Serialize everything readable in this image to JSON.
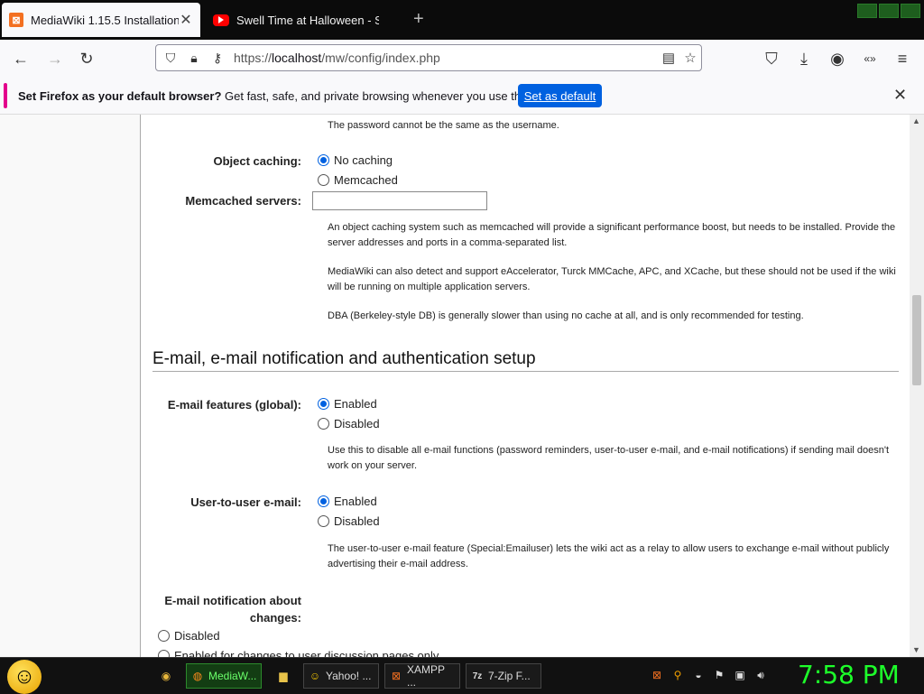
{
  "browser": {
    "tabs": [
      {
        "title": "MediaWiki 1.15.5 Installation",
        "active": true,
        "icon": "xampp-icon"
      },
      {
        "title": "Swell Time at Halloween - Shor",
        "active": false,
        "icon": "youtube-icon"
      }
    ],
    "new_tab_glyph": "+",
    "url": {
      "scheme": "https://",
      "host": "localhost",
      "path": "/mw/config/index.php"
    }
  },
  "notification": {
    "bold": "Set Firefox as your default browser?",
    "text": " Get fast, safe, and private browsing whenever you use the web.",
    "button": "Set as default"
  },
  "form": {
    "password_note": "The password cannot be the same as the username.",
    "object_caching": {
      "label": "Object caching:",
      "options": [
        "No caching",
        "Memcached"
      ],
      "selected": 0
    },
    "memcached": {
      "label": "Memcached servers:",
      "value": ""
    },
    "caching_help": [
      "An object caching system such as memcached will provide a significant performance boost, but needs to be installed. Provide the server addresses and ports in a comma-separated list.",
      "MediaWiki can also detect and support eAccelerator, Turck MMCache, APC, and XCache, but these should not be used if the wiki will be running on multiple application servers.",
      "DBA (Berkeley-style DB) is generally slower than using no cache at all, and is only recommended for testing."
    ],
    "section_heading": "E-mail, e-mail notification and authentication setup",
    "email_global": {
      "label": "E-mail features (global):",
      "options": [
        "Enabled",
        "Disabled"
      ],
      "selected": 0,
      "help": "Use this to disable all e-mail functions (password reminders, user-to-user e-mail, and e-mail notifications) if sending mail doesn't work on your server."
    },
    "user_email": {
      "label": "User-to-user e-mail:",
      "options": [
        "Enabled",
        "Disabled"
      ],
      "selected": 0,
      "help": "The user-to-user e-mail feature (Special:Emailuser) lets the wiki act as a relay to allow users to exchange e-mail without publicly advertising their e-mail address."
    },
    "notify": {
      "label_line1": "E-mail notification about",
      "label_line2": "changes:",
      "options": [
        "Disabled",
        "Enabled for changes to user discussion pages only"
      ],
      "selected": -1
    }
  },
  "taskbar": {
    "items": [
      {
        "label": "MediaW...",
        "icon": "firefox-icon",
        "active": true
      },
      {
        "label": "Yahoo! ...",
        "icon": "yahoo-icon",
        "active": false
      },
      {
        "label": "XAMPP ...",
        "icon": "xampp-icon",
        "active": false
      },
      {
        "label": "7-Zip F...",
        "icon": "7zip-icon",
        "active": false
      }
    ],
    "clock": "7:58 PM"
  }
}
